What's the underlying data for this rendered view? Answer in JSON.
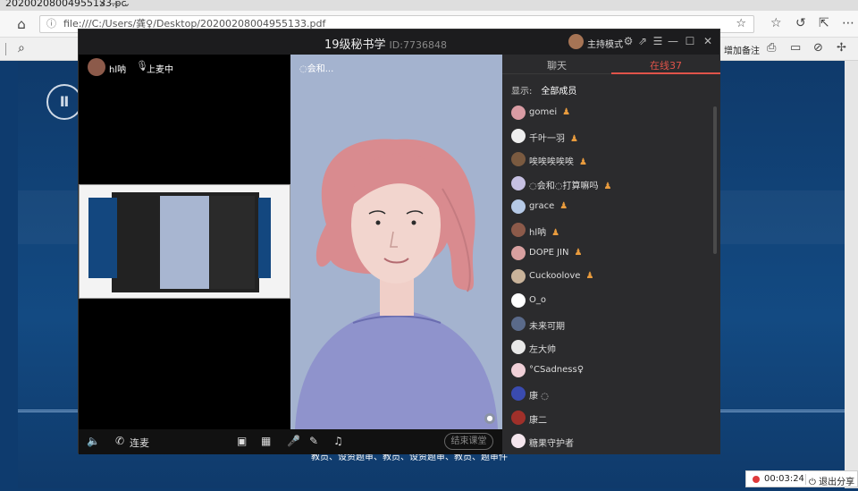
{
  "browser": {
    "tab_title": "20200208004955133.pc",
    "tab_controls": "×  —  ⌄",
    "address": "file:///C:/Users/龚♀/Desktop/20200208004955133.pdf",
    "toolbar_note": "增加备注"
  },
  "classroom": {
    "title": "19级秘书学",
    "room_id": "ID:7736848",
    "host_label": "主持模式",
    "speaker": {
      "name": "hl呐",
      "mic_status": "上麦中"
    },
    "preparing_label": "◌会和...",
    "controls": {
      "connect_label": "连麦",
      "end_label": "结束课堂"
    }
  },
  "side_panel": {
    "tabs": [
      {
        "label": "聊天"
      },
      {
        "label": "在线37"
      }
    ],
    "filter_label": "显示:",
    "filter_value": "全部成员",
    "members": [
      {
        "name": "gomei",
        "badge": "♟",
        "color": "#d99ca4"
      },
      {
        "name": "千叶一羽",
        "badge": "♟",
        "color": "#eeeeee"
      },
      {
        "name": "唉唉唉唉唉",
        "badge": "♟",
        "color": "#7a5a40"
      },
      {
        "name": "◌会和◌打算嘛吗",
        "badge": "♟",
        "color": "#c6c0e2"
      },
      {
        "name": "grace",
        "badge": "♟",
        "color": "#b5c9e6"
      },
      {
        "name": "hl呐",
        "badge": "♟",
        "color": "#8c5a4a"
      },
      {
        "name": "DOPE JIN",
        "badge": "♟",
        "color": "#d8a0a0"
      },
      {
        "name": "Cuckoolove",
        "badge": "♟",
        "color": "#c9b39a"
      },
      {
        "name": "O_o",
        "badge": "",
        "color": "#ffffff"
      },
      {
        "name": "未来可期",
        "badge": "",
        "color": "#5a6a8a"
      },
      {
        "name": "左大帅",
        "badge": "",
        "color": "#e8e8e8"
      },
      {
        "name": "°CSadness♀",
        "badge": "",
        "color": "#f0d0d8"
      },
      {
        "name": "康 ◌",
        "badge": "",
        "color": "#3a4bb0"
      },
      {
        "name": "康二",
        "badge": "",
        "color": "#a0302a"
      },
      {
        "name": "糖果守护者",
        "badge": "",
        "color": "#f5e6ee"
      }
    ]
  },
  "pdf": {
    "caption": "教员、设资题审、教员、设资题审、教员、题审件"
  },
  "recording": {
    "time": "00:03:24",
    "exit_label": "退出分享"
  },
  "colors": {
    "accent": "#e0544a",
    "badge": "#e89b3d",
    "pdf_bg": "#0f3a6b"
  }
}
